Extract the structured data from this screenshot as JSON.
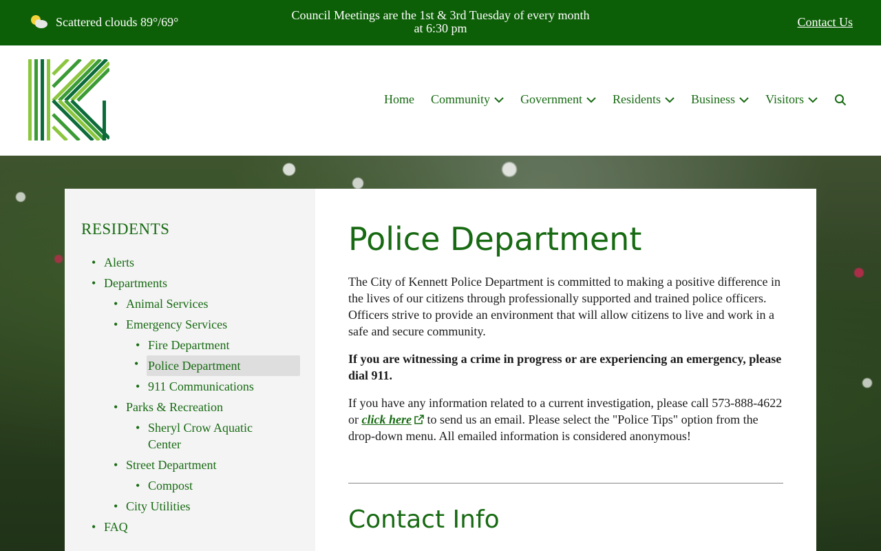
{
  "topbar": {
    "weather_icon": "partly-cloudy-icon",
    "weather_text": "Scattered clouds 89°/69°",
    "announcement_line1": "Council Meetings are the 1st & 3rd Tuesday of every month",
    "announcement_line2": "at 6:30 pm",
    "contact_label": "Contact Us",
    "bg_color": "#0d5f07"
  },
  "header": {
    "logo_icon": "kennett-k-logo",
    "nav": [
      {
        "label": "Home",
        "dropdown": false
      },
      {
        "label": "Community",
        "dropdown": true
      },
      {
        "label": "Government",
        "dropdown": true
      },
      {
        "label": "Residents",
        "dropdown": true
      },
      {
        "label": "Business",
        "dropdown": true
      },
      {
        "label": "Visitors",
        "dropdown": true
      }
    ],
    "search_icon": "search-icon",
    "accent_color": "#176a12"
  },
  "sidebar": {
    "title": "RESIDENTS",
    "items": [
      {
        "label": "Alerts",
        "level": 1
      },
      {
        "label": "Departments",
        "level": 1
      },
      {
        "label": "Animal Services",
        "level": 2
      },
      {
        "label": "Emergency Services",
        "level": 2
      },
      {
        "label": "Fire Department",
        "level": 3
      },
      {
        "label": "Police Department",
        "level": 3,
        "active": true
      },
      {
        "label": "911 Communications",
        "level": 3
      },
      {
        "label": "Parks & Recreation",
        "level": 2
      },
      {
        "label": "Sheryl Crow Aquatic Center",
        "level": 3
      },
      {
        "label": "Street Department",
        "level": 2
      },
      {
        "label": "Compost",
        "level": 3
      },
      {
        "label": "City Utilities",
        "level": 2
      },
      {
        "label": "FAQ",
        "level": 1
      }
    ]
  },
  "main": {
    "title": "Police Department",
    "intro": "The City of Kennett Police Department is committed to making a positive difference in the lives of our citizens through professionally supported and trained police officers. Officers strive to provide an environment that will allow citizens to live and work in a safe and secure community.",
    "emergency": "If you are witnessing a crime in progress or are experiencing an emergency, please dial 911.",
    "tips_before": "If you have any information related to a current investigation, please call 573-888-4622 or ",
    "tips_link": "click here",
    "tips_after": " to send us an email.  Please select the \"Police Tips\" option from the drop-down menu.  All emailed information is considered anonymous!",
    "contact_heading": "Contact Info"
  }
}
